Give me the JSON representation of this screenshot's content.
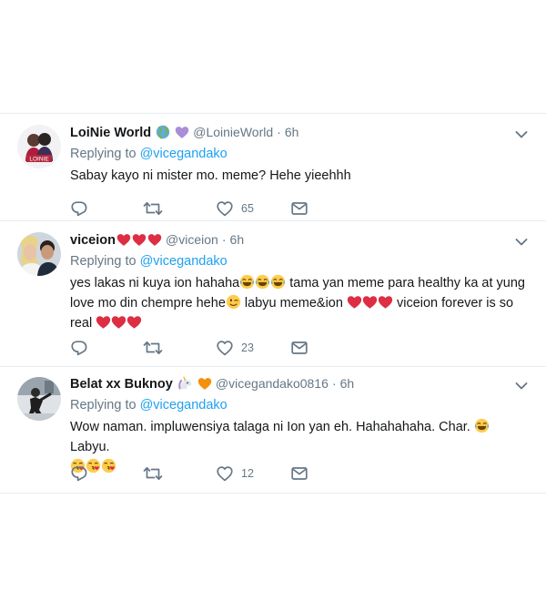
{
  "tweets": [
    {
      "name": "LoiNie World",
      "name_emojis": [
        "globe-icon",
        "purple-heart-icon"
      ],
      "handle": "@LoinieWorld",
      "separator": "·",
      "time": "6h",
      "reply_prefix": "Replying to",
      "reply_to": "@vicegandako",
      "text": "Sabay kayo ni mister mo. meme? Hehe yieehhh",
      "likes": "65",
      "avatar_text": "LOINIE"
    },
    {
      "name": "viceion",
      "name_emojis": [
        "red-heart-icon",
        "red-heart-icon",
        "red-heart-icon"
      ],
      "handle": "@viceion",
      "separator": "·",
      "time": "6h",
      "reply_prefix": "Replying to",
      "reply_to": "@vicegandako",
      "text_line1": "yes lakas ni kuya ion hahaha",
      "text_mid1": " tama yan meme para healthy ka at yung",
      "text_line2": "love mo din chempre hehe",
      "text_mid2": " labyu meme&ion ",
      "text_end": " viceion forever is so",
      "text_line3": "real",
      "likes": "23"
    },
    {
      "name": "Belat xx Buknoy",
      "name_emojis": [
        "unicorn-icon",
        "orange-heart-icon"
      ],
      "handle": "@vicegandako0816",
      "separator": "·",
      "time": "6h",
      "reply_prefix": "Replying to",
      "reply_to": "@vicegandako",
      "text_line1": "Wow naman. impluwensiya talaga ni Ion yan eh. Hahahahaha. Char.",
      "text_after": " Labyu.",
      "likes": "12"
    }
  ],
  "colors": {
    "accent": "#1da1f2",
    "muted": "#657786",
    "divider": "#e6ecf0",
    "heart_red": "#e0245e"
  }
}
